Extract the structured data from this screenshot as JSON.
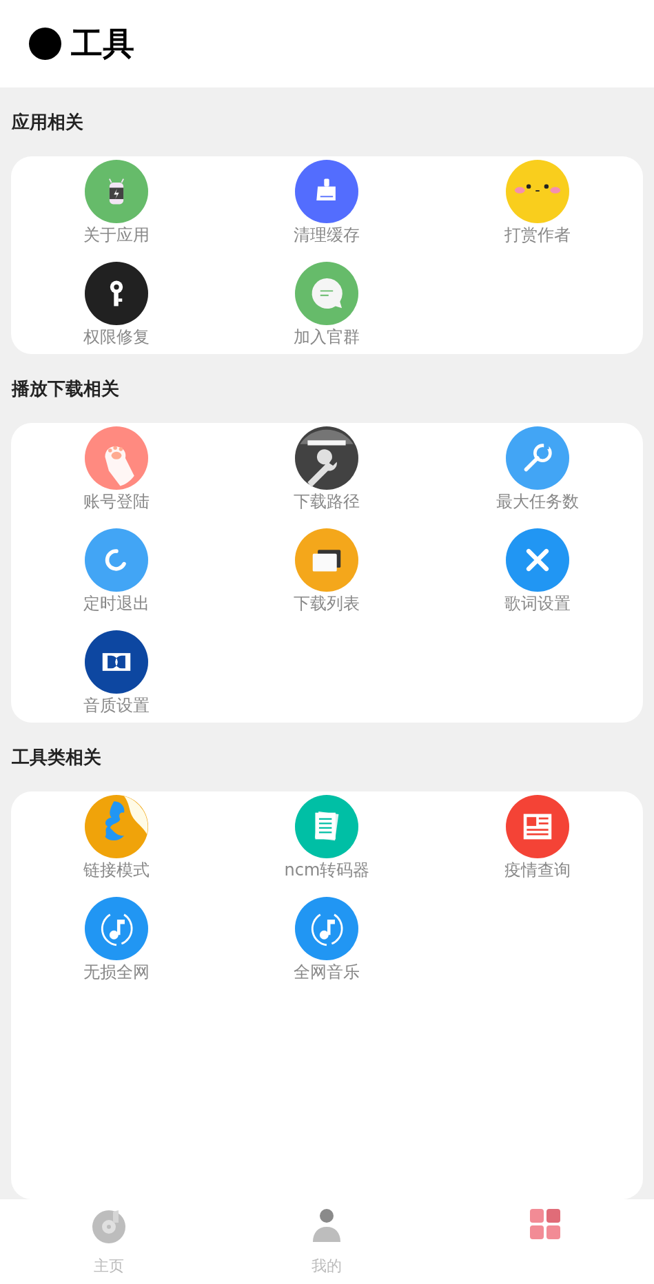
{
  "header": {
    "title": "工具"
  },
  "sections": [
    {
      "title": "应用相关",
      "items": [
        {
          "label": "关于应用"
        },
        {
          "label": "清理缓存"
        },
        {
          "label": "打赏作者"
        },
        {
          "label": "权限修复"
        },
        {
          "label": "加入官群"
        }
      ]
    },
    {
      "title": "播放下载相关",
      "items": [
        {
          "label": "账号登陆"
        },
        {
          "label": "下载路径"
        },
        {
          "label": "最大任务数"
        },
        {
          "label": "定时退出"
        },
        {
          "label": "下载列表"
        },
        {
          "label": "歌词设置"
        },
        {
          "label": "音质设置"
        }
      ]
    },
    {
      "title": "工具类相关",
      "items": [
        {
          "label": "链接模式"
        },
        {
          "label": "ncm转码器"
        },
        {
          "label": "疫情查询"
        },
        {
          "label": "无损全网"
        },
        {
          "label": "全网音乐"
        }
      ]
    }
  ],
  "bottom_nav": [
    {
      "label": "主页",
      "selected": false
    },
    {
      "label": "我的",
      "selected": false
    },
    {
      "selected": true
    }
  ]
}
